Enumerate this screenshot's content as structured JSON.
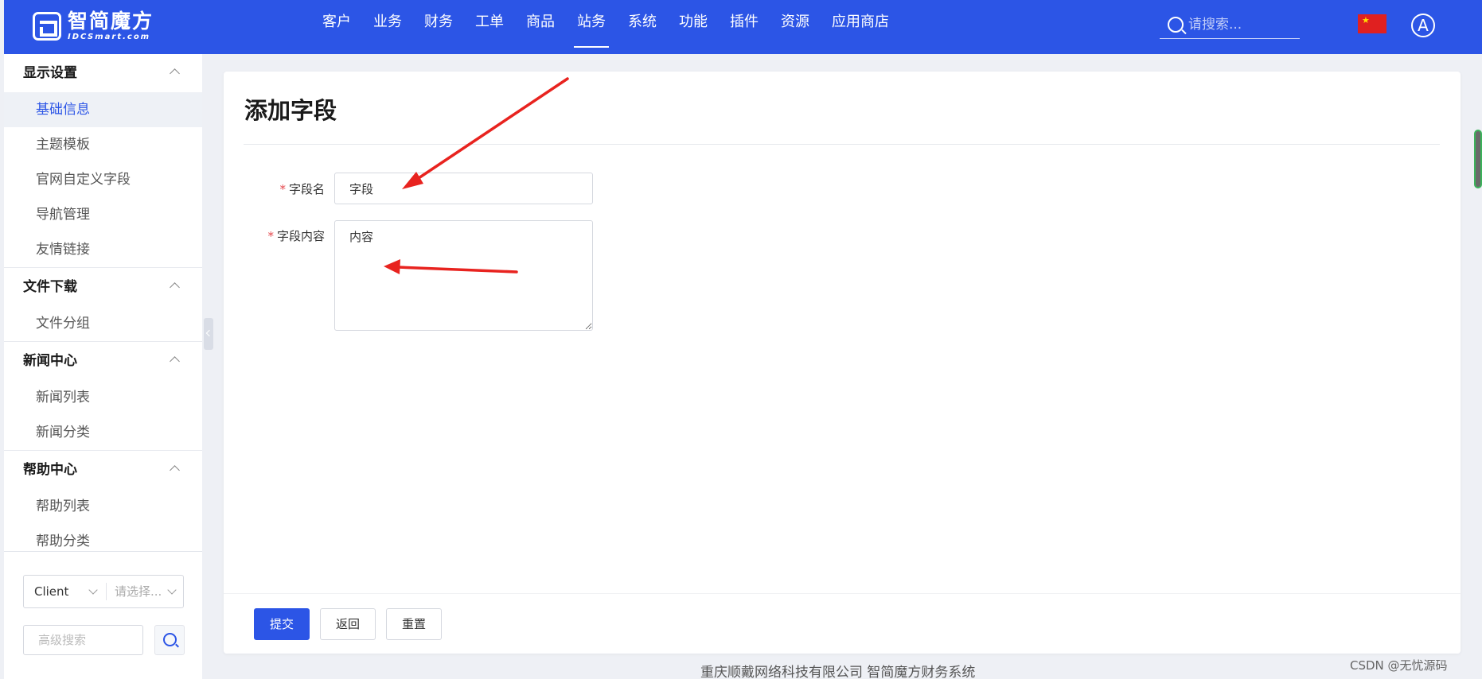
{
  "header": {
    "logo_cn": "智简魔方",
    "logo_en": "IDCSmart.com",
    "nav": [
      {
        "label": "客户",
        "active": false
      },
      {
        "label": "业务",
        "active": false
      },
      {
        "label": "财务",
        "active": false
      },
      {
        "label": "工单",
        "active": false
      },
      {
        "label": "商品",
        "active": false
      },
      {
        "label": "站务",
        "active": true
      },
      {
        "label": "系统",
        "active": false
      },
      {
        "label": "功能",
        "active": false
      },
      {
        "label": "插件",
        "active": false
      },
      {
        "label": "资源",
        "active": false
      },
      {
        "label": "应用商店",
        "active": false
      }
    ],
    "search_placeholder": "请搜索...",
    "flag_icon": "china-flag-icon",
    "avatar_letter": "A"
  },
  "sidebar": {
    "groups": [
      {
        "title": "显示设置",
        "items": [
          "基础信息",
          "主题模板",
          "官网自定义字段",
          "导航管理",
          "友情链接"
        ]
      },
      {
        "title": "文件下载",
        "items": [
          "文件分组"
        ]
      },
      {
        "title": "新闻中心",
        "items": [
          "新闻列表",
          "新闻分类"
        ]
      },
      {
        "title": "帮助中心",
        "items": [
          "帮助列表",
          "帮助分类"
        ]
      }
    ],
    "active_item": "基础信息",
    "select_left": "Client",
    "select_right_placeholder": "请选择...",
    "advanced_search_placeholder": "高级搜索"
  },
  "form": {
    "title": "添加字段",
    "field_name_label": "字段名",
    "field_name_value": "字段",
    "field_content_label": "字段内容",
    "field_content_value": "内容",
    "submit_label": "提交",
    "back_label": "返回",
    "reset_label": "重置"
  },
  "footer": {
    "company": "重庆顺戴网络科技有限公司 智简魔方财务系统",
    "watermark": "CSDN @无忧源码"
  },
  "colors": {
    "primary": "#2c55e6",
    "annotation_arrow": "#e8231f",
    "required": "#e5484d"
  }
}
